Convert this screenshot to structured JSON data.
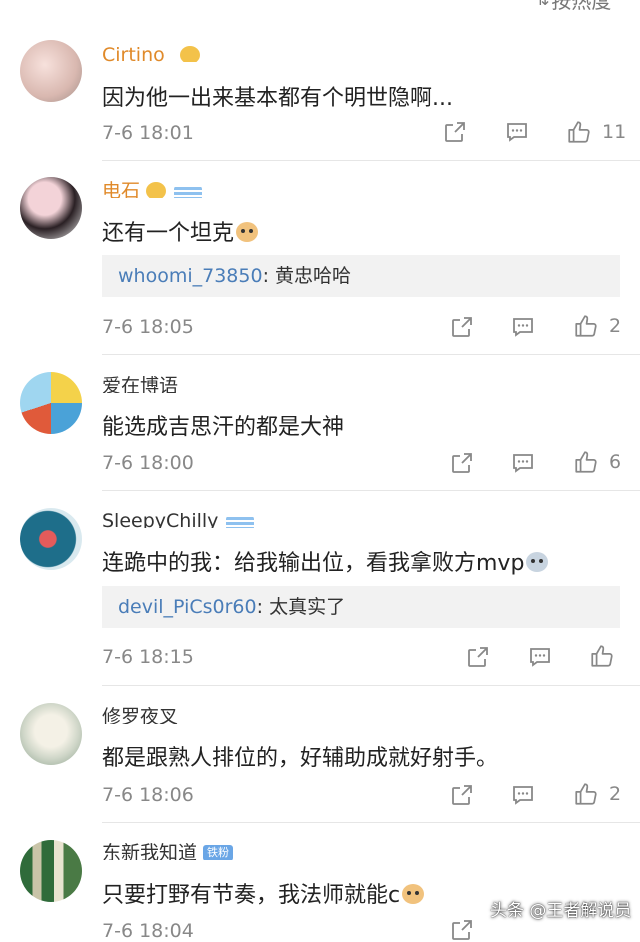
{
  "header": {
    "sort_label": "按热度"
  },
  "comments": [
    {
      "username": "Cirtino_",
      "text": "因为他一出来基本都有个明世隐啊...",
      "time": "7-6 18:01",
      "likes": "11"
    },
    {
      "username": "电石",
      "text": "还有一个坦克",
      "reply_user": "whoomi_73850",
      "reply_text": ": 黄忠哈哈",
      "time": "7-6 18:05",
      "likes": "2"
    },
    {
      "username": "爱在博语",
      "text": "能选成吉思汗的都是大神",
      "time": "7-6 18:00",
      "likes": "6"
    },
    {
      "username": "SleepyChilly",
      "text": "连跪中的我：给我输出位，看我拿败方mvp",
      "reply_user": "devil_PiCs0r60",
      "reply_text": ": 太真实了",
      "time": "7-6 18:15",
      "likes": ""
    },
    {
      "username": "修罗夜叉",
      "text": "都是跟熟人排位的，好辅助成就好射手。",
      "time": "7-6 18:06",
      "likes": "2"
    },
    {
      "username": "东新我知道",
      "badge": "铁粉",
      "text": "只要打野有节奏，我法师就能c",
      "time": "7-6 18:04",
      "likes": ""
    }
  ],
  "watermark": "头条 @王者解说员",
  "icons": {
    "repost": "share-icon",
    "comment": "comment-icon",
    "like": "thumbs-up-icon"
  },
  "colors": {
    "link": "#4a7db8",
    "meta": "#888888",
    "reply_bg": "#f2f2f2"
  }
}
